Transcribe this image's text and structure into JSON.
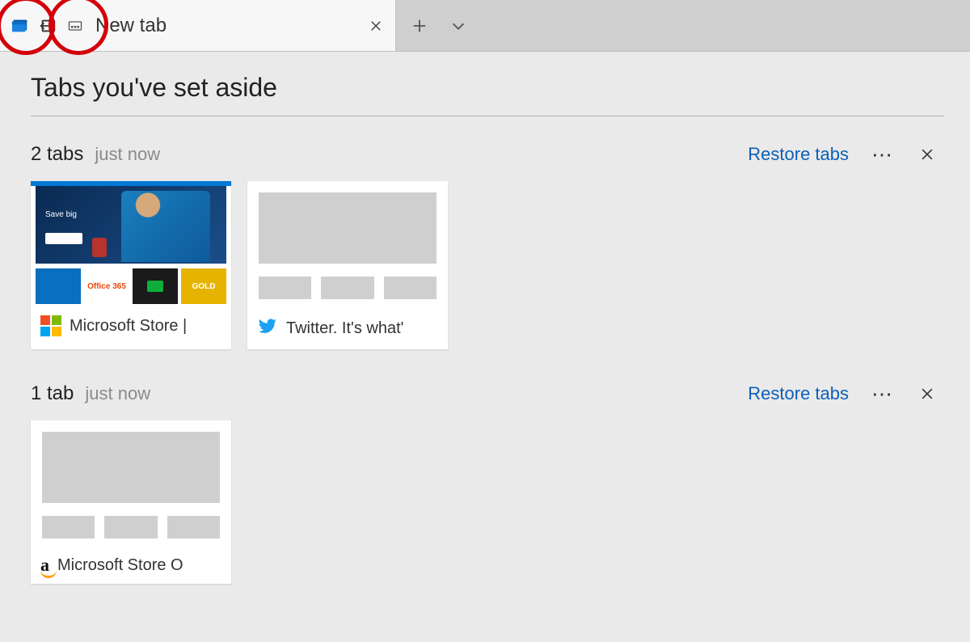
{
  "tabbar": {
    "active_tab_title": "New tab",
    "icons": {
      "show_aside": "tabs-aside-icon",
      "set_aside": "set-aside-icon",
      "preview": "tab-preview-icon"
    }
  },
  "page": {
    "title": "Tabs you've set aside"
  },
  "groups": [
    {
      "count_label": "2 tabs",
      "time_label": "just now",
      "restore_label": "Restore tabs",
      "tiles": [
        {
          "favicon": "microsoft",
          "label": "Microsoft Store |"
        },
        {
          "favicon": "twitter",
          "label": "Twitter. It's what'"
        }
      ]
    },
    {
      "count_label": "1 tab",
      "time_label": "just now",
      "restore_label": "Restore tabs",
      "tiles": [
        {
          "favicon": "amazon",
          "label": "Microsoft Store O"
        }
      ]
    }
  ]
}
